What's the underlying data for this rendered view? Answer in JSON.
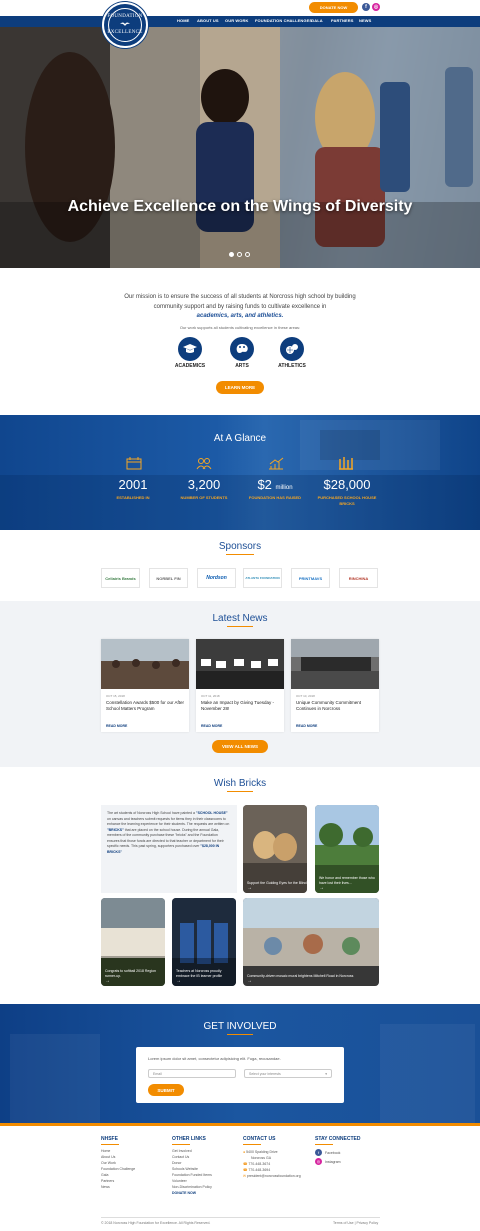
{
  "header": {
    "logo_top": "FOUNDATION",
    "logo_bottom": "EXCELLENCE",
    "nav": [
      "HOME",
      "ABOUT US",
      "OUR WORK",
      "FOUNDATION CHALLENGES",
      "GALA",
      "PARTNERS",
      "NEWS"
    ],
    "donate_label": "DONATE NOW",
    "social": [
      "facebook-icon",
      "instagram-icon"
    ]
  },
  "hero": {
    "title": "Achieve Excellence on the Wings of Diversity",
    "slides": 3,
    "active_slide": 1
  },
  "mission": {
    "text": "Our mission is to ensure the success of all students at Norcross high school by building community support and by raising funds to cultivate excellence in",
    "emphasis": "academics, arts, and athletics.",
    "sub": "Our work supports all students cultivating excellence in these areas:",
    "areas": [
      {
        "label": "ACADEMICS",
        "icon": "graduation-cap-icon"
      },
      {
        "label": "ARTS",
        "icon": "palette-icon"
      },
      {
        "label": "ATHLETICS",
        "icon": "ball-icon"
      }
    ],
    "button": "LEARN MORE"
  },
  "glance": {
    "title": "At A Glance",
    "stats": [
      {
        "value": "2001",
        "unit": "",
        "label": "ESTABLISHED IN",
        "icon": "calendar-icon"
      },
      {
        "value": "3,200",
        "unit": "",
        "label": "NUMBER OF STUDENTS",
        "icon": "students-icon"
      },
      {
        "value": "$2",
        "unit": "million",
        "label": "FOUNDATION HAS RAISED",
        "icon": "growth-chart-icon"
      },
      {
        "value": "$28,000",
        "unit": "",
        "label": "PURCHASED SCHOOL HOUSE BRICKS",
        "icon": "bricks-icon"
      }
    ]
  },
  "sponsors": {
    "title": "Sponsors",
    "items": [
      "Cellairis Brands",
      "NORBEL FIN",
      "Nordson",
      "ATLANTA FOUNDATION",
      "PRINTMAVS",
      "RINCHINA"
    ]
  },
  "news": {
    "title": "Latest News",
    "items": [
      {
        "date": "OCT 15, 2018",
        "title": "Constellation Awards $500 for our After School Matters Program",
        "more": "READ MORE"
      },
      {
        "date": "OCT 11, 2018",
        "title": "Make an Impact by Giving Tuesday - November 28!",
        "more": "READ MORE"
      },
      {
        "date": "OCT 10, 2018",
        "title": "Unique Community Commitment Continues in Norcross",
        "more": "READ MORE"
      }
    ],
    "button": "VIEW ALL NEWS"
  },
  "wish_bricks": {
    "title": "Wish Bricks",
    "text_a": "The art students of Norcross High School have painted a",
    "text_b": "\"SCHOOL HOUSE\"",
    "text_c": "on canvas and teachers submit requests for items they in their classrooms to enhance the learning experience for their students. The requests are written on",
    "text_d": "\"BRICKS\"",
    "text_e": "that are placed on the school house. During the annual Gala, members of the community purchase these \"bricks\" and the Foundation ensures that those funds are directed to that teacher or department for their specific needs. This past spring, supporters purchased over",
    "text_f": "\"$28,000 IN BRICKS\"",
    "tiles": [
      {
        "caption": "Support the Guiding Eyes for the Blind"
      },
      {
        "caption": "We honor and remember those who have lost their lives..."
      },
      {
        "caption": "Congrats to softball 2018 Region runner-up."
      },
      {
        "caption": "Teachers at Norcross proudly embrace the IB learner profile"
      },
      {
        "caption": "Community-driven mosaic mural brightens Mitchell Road in Norcross"
      }
    ]
  },
  "get_involved": {
    "title": "GET INVOLVED",
    "lead": "Lorem ipsum dolor sit amet, consectetur adipisicing elit. Fuga, recusandae.",
    "email_placeholder": "Email",
    "interests_placeholder": "Select your interests",
    "button": "SUBMIT"
  },
  "footer": {
    "col1_title": "NHSFE",
    "col1_links": [
      "Home",
      "About Us",
      "Our Work",
      "Foundation Challenge",
      "Gala",
      "Partners",
      "News"
    ],
    "col2_title": "OTHER LINKS",
    "col2_links": [
      "Get Involved",
      "Contact Us",
      "Donor",
      "Schools Website",
      "Foundation Funded Items",
      "Volunteer",
      "Non-Discrimination Policy"
    ],
    "col2_donate": "DONATE NOW",
    "col3_title": "CONTACT US",
    "contact": [
      "5400 Spalding Drive",
      "Norcross GA",
      "770-448-3674",
      "770-448-3694",
      "president@norcrossfoundation.org"
    ],
    "col4_title": "STAY CONNECTED",
    "social": [
      "Facebook",
      "Instagram"
    ],
    "copyright": "© 2018 Norcross High Foundation for Excellence. All Rights Reserved.",
    "legal": "Terms of Use | Privacy Policy"
  },
  "colors": {
    "navy": "#0d3d7d",
    "orange": "#f28c00",
    "accent_blue": "#1d4f96"
  }
}
